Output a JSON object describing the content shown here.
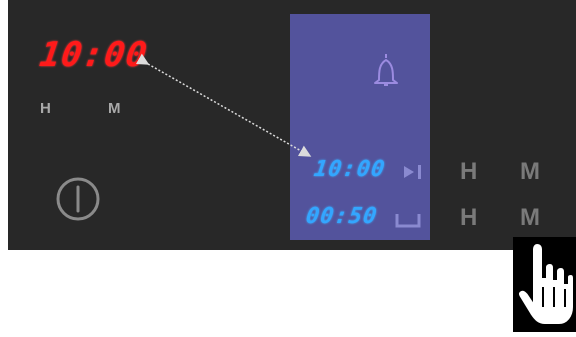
{
  "clock": {
    "time": "10:00",
    "hours_label": "H",
    "minutes_label": "M"
  },
  "lcd": {
    "end_time": "10:00",
    "duration": "00:50",
    "end_hours_label": "H",
    "end_minutes_label": "M",
    "duration_hours_label": "H",
    "duration_minutes_label": "M"
  },
  "icons": {
    "power": "power-icon",
    "bell": "bell-icon",
    "end": "end-time-icon",
    "duration": "duration-icon",
    "pointer": "hand-pointer-icon"
  },
  "colors": {
    "panel": "#282828",
    "lcd": "#53539c",
    "clock_digits": "#ff1a1a",
    "lcd_digits": "#33a6ff"
  }
}
